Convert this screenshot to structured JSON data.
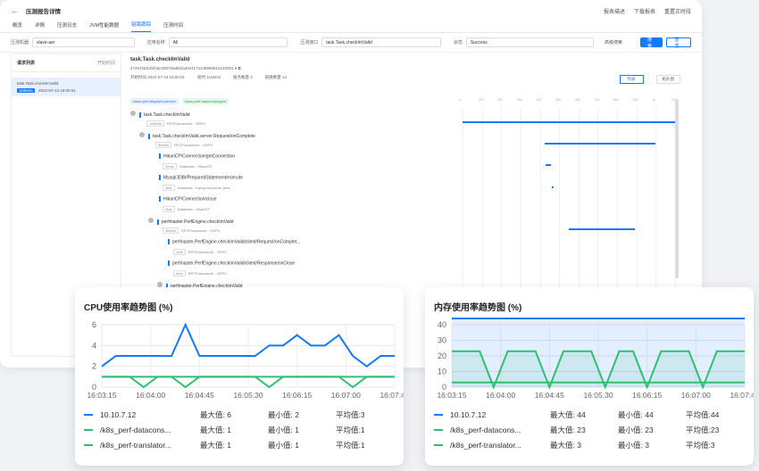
{
  "app": {
    "title": "压测报告详情",
    "actions": [
      "报表描述",
      "下载报表",
      "重置正时段"
    ]
  },
  "tabs": [
    "概览",
    "详情",
    "压测日志",
    "JVM性能数据",
    "链路跟踪",
    "压测时间"
  ],
  "active_tab": 4,
  "filters": {
    "f1_label": "压测机器",
    "f1_value": "slave-aer",
    "f2_label": "应用名称",
    "f2_value": "All",
    "f3_label": "压测接口",
    "f3_value": "task.Task.checkImValid",
    "f4_label": "状态",
    "f4_value": "Success",
    "advanced": "高级搜索",
    "search_btn": "搜索",
    "reset_btn": "重置"
  },
  "left_panel": {
    "title": "请求列表",
    "sort": "开始时间",
    "item_name": "task.Task.checkImValid",
    "item_badge": "1106ms",
    "item_time": "2022-07-13 15:00:01"
  },
  "detail": {
    "title": "task.Task.checkImValid",
    "trace_id": "27491f4dc2bf4dc08870ad91fa4041174148990810220001",
    "start_time": "开始时间 2022-07-13 15:00:01",
    "duration": "耗时 1106ms",
    "depth": "服务数量 2",
    "span_count": "链路数量 14",
    "list_btn": "列表",
    "topo_btn": "拓扑图",
    "tags": [
      "slave-perf-dispatch-service",
      "slave-perf-datacompagine"
    ],
    "ticks": [
      "0",
      "100",
      "200",
      "300",
      "400",
      "500",
      "600",
      "700",
      "800",
      "900",
      "1k",
      "1.1k"
    ]
  },
  "spans": [
    {
      "name": "task.Task.checkImValid",
      "dur": "1106ms",
      "meta": "RPCFramework - GRPC"
    },
    {
      "name": "task.Task.checkImValid.server.Request/onComplete",
      "dur": "569ms",
      "meta": "RPCFramework - GRPC"
    },
    {
      "name": "HikariCP/Connection/getConnection",
      "dur": "20ms",
      "meta": "Database - HikariCP"
    },
    {
      "name": "Mysql/JDBI/PreparedStatement/execute",
      "dur": "3ms",
      "meta": "Database - mysql-connector-java"
    },
    {
      "name": "HikariCP/Connection/close",
      "dur": "0ms",
      "meta": "Database - HikariCP"
    },
    {
      "name": "perfmaster.PerfEngine.checkImValid",
      "dur": "366ms",
      "meta": "RPCFramework - GRPC"
    },
    {
      "name": "perfmaster.PerfEngine.checkImValid/client/Request/onComplet...",
      "dur": "1ms",
      "meta": "RPCFramework - GRPC"
    },
    {
      "name": "perfmaster.PerfEngine.checkImValid/client/Response/onClose",
      "dur": "0ms",
      "meta": "RPCFramework - GRPC"
    },
    {
      "name": "perfmaster.PerfEngine.checkImValid",
      "dur": "",
      "meta": ""
    }
  ],
  "cpu_card": {
    "title": "CPU使用率趋势图 (%)",
    "max_label": "最大值:",
    "min_label": "最小值:",
    "avg_label": "平均值:",
    "rows": [
      {
        "name": "10.10.7.12",
        "max": "6",
        "min": "2",
        "avg": "3",
        "color": "#1677ff"
      },
      {
        "name": "/k8s_perf-datacons...",
        "max": "1",
        "min": "1",
        "avg": "1",
        "color": "#2fbf71"
      },
      {
        "name": "/k8s_perf-translator...",
        "max": "1",
        "min": "1",
        "avg": "1",
        "color": "#2fbf71"
      }
    ]
  },
  "mem_card": {
    "title": "内存使用率趋势图 (%)",
    "max_label": "最大值:",
    "min_label": "最小值:",
    "avg_label": "平均值:",
    "rows": [
      {
        "name": "10.10.7.12",
        "max": "44",
        "min": "44",
        "avg": "44",
        "color": "#1677ff"
      },
      {
        "name": "/k8s_perf-datacons...",
        "max": "23",
        "min": "23",
        "avg": "23",
        "color": "#2fbf71"
      },
      {
        "name": "/k8s_perf-translator...",
        "max": "3",
        "min": "3",
        "avg": "3",
        "color": "#2fbf71"
      }
    ]
  },
  "chart_data": [
    {
      "type": "line",
      "title": "CPU使用率趋势图 (%)",
      "x": [
        "16:03:15",
        "16:04:00",
        "16:04:45",
        "16:05:30",
        "16:06:15",
        "16:07:00",
        "16:07:45"
      ],
      "ylim": [
        0,
        6
      ],
      "yticks": [
        0,
        2,
        4,
        6
      ],
      "series": [
        {
          "name": "10.10.7.12",
          "color": "#1677ff",
          "fill": false,
          "values": [
            2,
            3,
            3,
            3,
            3,
            3,
            6,
            3,
            3,
            3,
            3,
            3,
            4,
            4,
            5,
            4,
            4,
            5,
            3,
            2,
            3,
            3
          ]
        },
        {
          "name": "/k8s_perf-datacons...",
          "color": "#2fbf71",
          "fill": false,
          "values": [
            1,
            1,
            1,
            0,
            1,
            1,
            0,
            1,
            1,
            1,
            1,
            1,
            0,
            1,
            1,
            1,
            1,
            1,
            0,
            1,
            1,
            1
          ]
        },
        {
          "name": "/k8s_perf-translator...",
          "color": "#2fbf71",
          "fill": false,
          "values": [
            1,
            1,
            1,
            1,
            1,
            1,
            1,
            1,
            1,
            1,
            1,
            1,
            1,
            1,
            1,
            1,
            1,
            1,
            1,
            1,
            1,
            1
          ]
        }
      ]
    },
    {
      "type": "area",
      "title": "内存使用率趋势图 (%)",
      "x": [
        "16:03:15",
        "16:04:00",
        "16:04:45",
        "16:05:30",
        "16:06:15",
        "16:07:00",
        "16:07:45"
      ],
      "ylim": [
        0,
        40
      ],
      "yticks": [
        0,
        10,
        20,
        30,
        40
      ],
      "series": [
        {
          "name": "10.10.7.12",
          "color": "#1677ff",
          "fill": true,
          "values": [
            44,
            44,
            44,
            44,
            44,
            44,
            44,
            44,
            44,
            44,
            44,
            44,
            44,
            44,
            44,
            44,
            44,
            44,
            44,
            44,
            44,
            44
          ]
        },
        {
          "name": "/k8s_perf-datacons...",
          "color": "#2fbf71",
          "fill": true,
          "values": [
            23,
            23,
            23,
            0,
            23,
            23,
            23,
            0,
            23,
            23,
            23,
            0,
            23,
            23,
            0,
            23,
            23,
            23,
            0,
            23,
            23,
            23
          ]
        },
        {
          "name": "/k8s_perf-translator...",
          "color": "#2fbf71",
          "fill": false,
          "values": [
            3,
            3,
            3,
            3,
            3,
            3,
            3,
            3,
            3,
            3,
            3,
            3,
            3,
            3,
            3,
            3,
            3,
            3,
            3,
            3,
            3,
            3
          ]
        }
      ]
    }
  ]
}
